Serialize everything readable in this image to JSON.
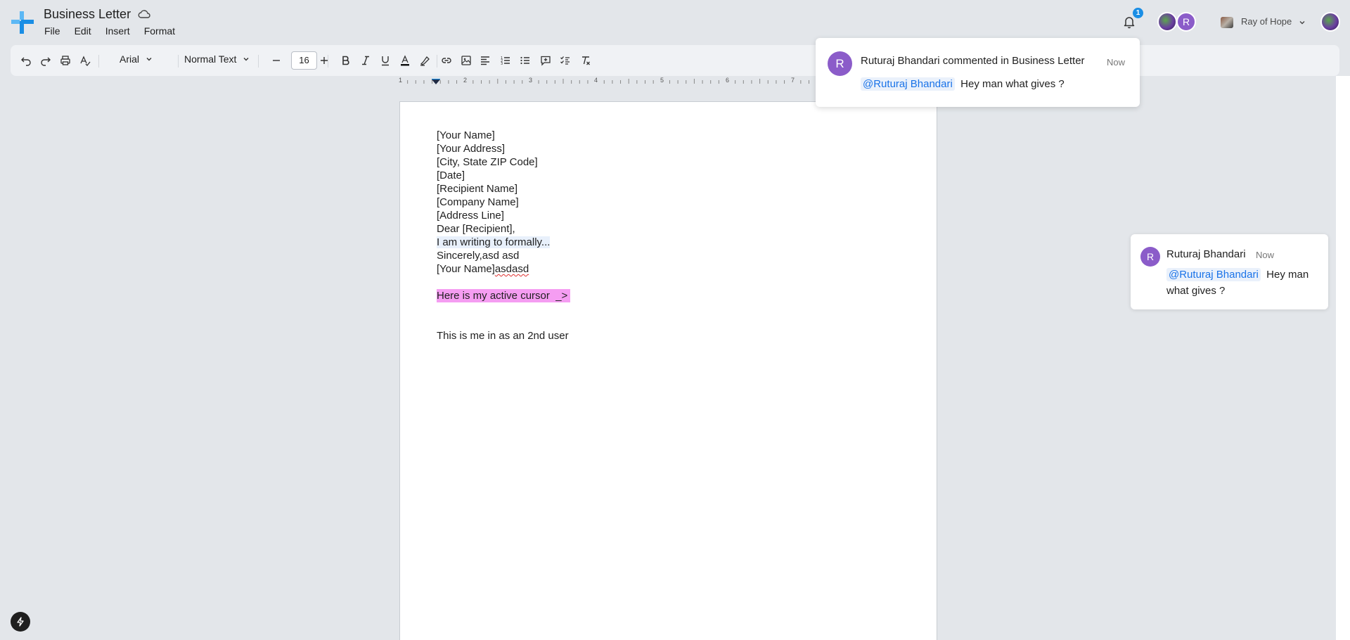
{
  "app": {
    "doc_title": "Business Letter",
    "menu": [
      "File",
      "Edit",
      "Insert",
      "Format"
    ]
  },
  "header": {
    "notification_count": "1",
    "avatar_initial": "R",
    "workspace_name": "Ray of Hope"
  },
  "toolbar": {
    "font": "Arial",
    "text_style": "Normal Text",
    "font_size": "16"
  },
  "ruler": {
    "labels": [
      "1",
      "2",
      "3",
      "4",
      "5",
      "6",
      "7"
    ]
  },
  "document": {
    "lines": [
      "[Your Name]",
      "[Your Address]",
      "[City, State ZIP Code]",
      "[Date]",
      "[Recipient Name]",
      "[Company Name]",
      "[Address Line]",
      "Dear [Recipient],",
      "I am writing to formally...",
      "Sincerely,asd asd"
    ],
    "signature_prefix": "[Your Name]",
    "signature_suffix": "asdasd",
    "cursor_text": "Here is my active cursor  _>",
    "second_user_text": "This is me in as an 2nd user"
  },
  "notification": {
    "avatar_initial": "R",
    "author": "Ruturaj Bhandari",
    "action": "commented in",
    "doc": "Business Letter",
    "time": "Now",
    "mention": "@Ruturaj Bhandari",
    "message": "Hey man what gives ?"
  },
  "comment": {
    "avatar_initial": "R",
    "author": "Ruturaj Bhandari",
    "time": "Now",
    "mention": "@Ruturaj Bhandari",
    "message": "Hey man what gives ?"
  },
  "colors": {
    "accent": "#1a8ee5",
    "avatar": "#8b5cc9",
    "cursor_highlight": "#f59df2",
    "mention": "#1a73e8"
  }
}
